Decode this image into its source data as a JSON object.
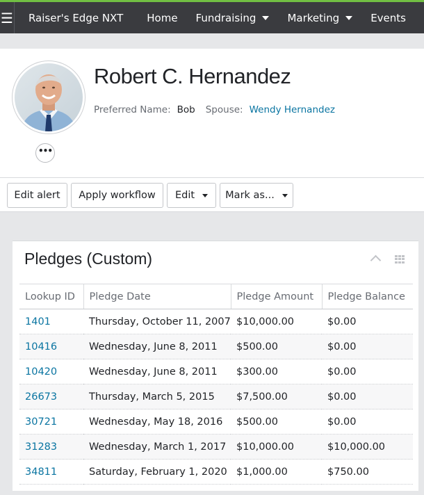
{
  "nav": {
    "brand": "Raiser's Edge NXT",
    "items": [
      {
        "label": "Home",
        "dropdown": false
      },
      {
        "label": "Fundraising",
        "dropdown": true
      },
      {
        "label": "Marketing",
        "dropdown": true
      },
      {
        "label": "Events",
        "dropdown": false
      }
    ]
  },
  "profile": {
    "name": "Robert C. Hernandez",
    "preferred_label": "Preferred Name:",
    "preferred_value": "Bob",
    "spouse_label": "Spouse:",
    "spouse_value": "Wendy Hernandez",
    "more_label": "•••"
  },
  "actions": {
    "edit_alert": "Edit alert",
    "apply_workflow": "Apply workflow",
    "edit": "Edit",
    "mark_as": "Mark as..."
  },
  "tile": {
    "title": "Pledges (Custom)",
    "columns": [
      "Lookup ID",
      "Pledge Date",
      "Pledge Amount",
      "Pledge Balance"
    ],
    "rows": [
      [
        "1401",
        "Thursday, October 11, 2007",
        "$10,000.00",
        "$0.00"
      ],
      [
        "10416",
        "Wednesday, June 8, 2011",
        "$500.00",
        "$0.00"
      ],
      [
        "10420",
        "Wednesday, June 8, 2011",
        "$300.00",
        "$0.00"
      ],
      [
        "26673",
        "Thursday, March 5, 2015",
        "$7,500.00",
        "$0.00"
      ],
      [
        "30721",
        "Wednesday, May 18, 2016",
        "$500.00",
        "$0.00"
      ],
      [
        "31283",
        "Wednesday, March 1, 2017",
        "$10,000.00",
        "$10,000.00"
      ],
      [
        "34811",
        "Saturday, February 1, 2020",
        "$1,000.00",
        "$750.00"
      ]
    ]
  },
  "colors": {
    "nav_bg": "#3a3b3f",
    "nav_accent": "#71bf43",
    "link": "#0974a1"
  }
}
